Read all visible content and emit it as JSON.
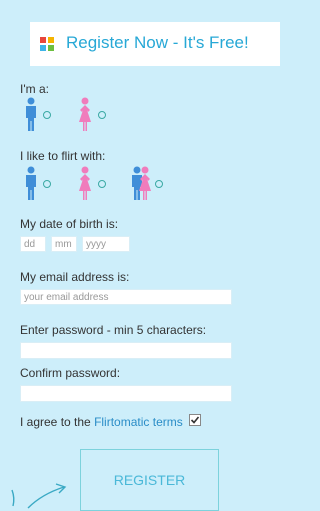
{
  "banner": {
    "title": "Register Now - It's Free!"
  },
  "form": {
    "gender_label": "I'm a:",
    "flirt_label": "I like to flirt with:",
    "dob_label": "My date of birth is:",
    "dob_day_placeholder": "dd",
    "dob_month_placeholder": "mm",
    "dob_year_placeholder": "yyyy",
    "email_label": "My email address is:",
    "email_placeholder": "your email address",
    "password_label": "Enter password - min 5 characters:",
    "confirm_label": "Confirm password:",
    "agree_prefix": "I agree to the ",
    "agree_link": "Flirtomatic terms",
    "agree_checked": true,
    "register_label": "REGISTER"
  },
  "icons": {
    "male": "male-figure-icon",
    "female": "female-figure-icon",
    "couple": "couple-figure-icon",
    "logo": "four-squares-logo-icon"
  },
  "colors": {
    "background": "#cdeefa",
    "accent": "#27a8d6",
    "male": "#3f8ed8",
    "female": "#f07cbc",
    "logo": [
      "#e8473c",
      "#f5b400",
      "#3db4e8",
      "#6cbf3e"
    ]
  }
}
